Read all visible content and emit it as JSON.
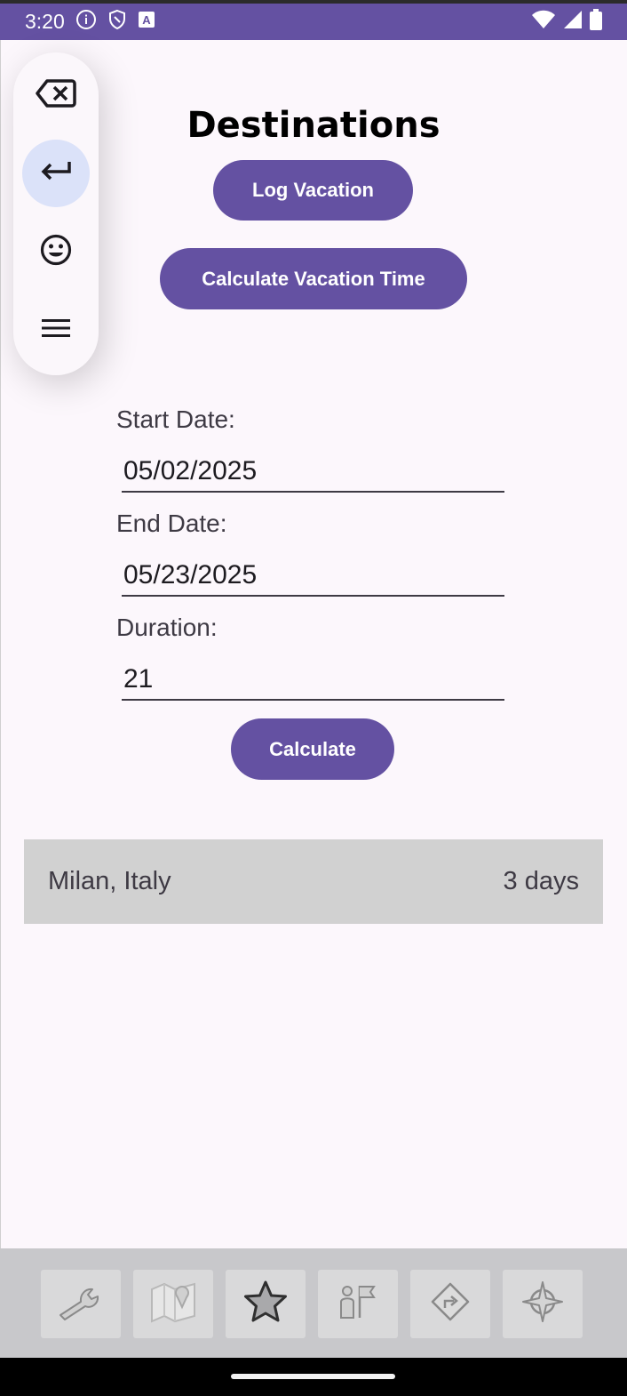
{
  "status_bar": {
    "time": "3:20",
    "left_icons": [
      "info-icon",
      "shield-icon",
      "text-a-icon"
    ],
    "right_icons": [
      "wifi-icon",
      "signal-icon",
      "battery-icon"
    ],
    "color": "#6451a2"
  },
  "header": {
    "title": "Destinations"
  },
  "actions": {
    "log_vacation_label": "Log Vacation",
    "calculate_vacation_time_label": "Calculate Vacation Time"
  },
  "form": {
    "start_date_label": "Start Date:",
    "start_date_value": "05/02/2025",
    "end_date_label": "End Date:",
    "end_date_value": "05/23/2025",
    "duration_label": "Duration:",
    "duration_value": "21",
    "calculate_label": "Calculate"
  },
  "destinations": [
    {
      "name": "Milan, Italy",
      "duration": "3 days"
    }
  ],
  "floating_keyboard": {
    "buttons": [
      "backspace-icon",
      "enter-icon",
      "emoji-icon",
      "menu-icon"
    ],
    "active_index": 1
  },
  "bottom_nav": {
    "tabs": [
      "wrench-icon",
      "map-icon",
      "star-icon",
      "person-flag-icon",
      "directions-icon",
      "compass-icon"
    ]
  },
  "colors": {
    "accent": "#6451a2",
    "background": "#fcf7fc",
    "list_row": "#d1d1d1"
  }
}
